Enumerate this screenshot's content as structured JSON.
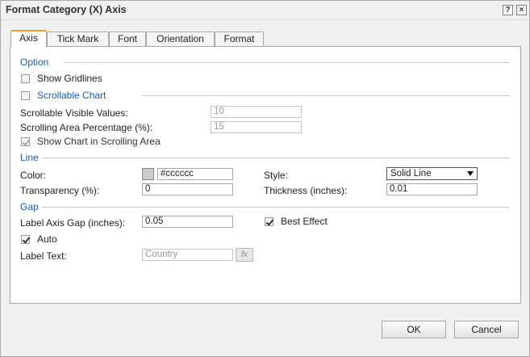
{
  "window": {
    "title": "Format Category (X) Axis",
    "help_label": "?",
    "close_label": "×"
  },
  "tabs": [
    {
      "label": "Axis",
      "active": true
    },
    {
      "label": "Tick Mark"
    },
    {
      "label": "Font"
    },
    {
      "label": "Orientation"
    },
    {
      "label": "Format"
    }
  ],
  "option": {
    "heading": "Option",
    "show_gridlines": {
      "label": "Show Gridlines",
      "checked": false
    },
    "scrollable_chart": {
      "label": "Scrollable Chart",
      "checked": false
    },
    "visible_values": {
      "label": "Scrollable Visible Values:",
      "value": "10"
    },
    "area_percentage": {
      "label": "Scrolling Area Percentage (%):",
      "value": "15"
    },
    "show_in_area": {
      "label": "Show Chart in Scrolling Area",
      "checked": true
    }
  },
  "line": {
    "heading": "Line",
    "color_label": "Color:",
    "color_value": "#cccccc",
    "style_label": "Style:",
    "style_value": "Solid Line",
    "transparency_label": "Transparency (%):",
    "transparency_value": "0",
    "thickness_label": "Thickness (inches):",
    "thickness_value": "0.01"
  },
  "gap": {
    "heading": "Gap",
    "axis_gap_label": "Label Axis Gap (inches):",
    "axis_gap_value": "0.05",
    "best_effect": {
      "label": "Best Effect",
      "checked": true
    },
    "auto": {
      "label": "Auto",
      "checked": true
    },
    "label_text_label": "Label Text:",
    "label_text_placeholder": "Country",
    "fx_label": "fx"
  },
  "buttons": {
    "ok": "OK",
    "cancel": "Cancel"
  }
}
